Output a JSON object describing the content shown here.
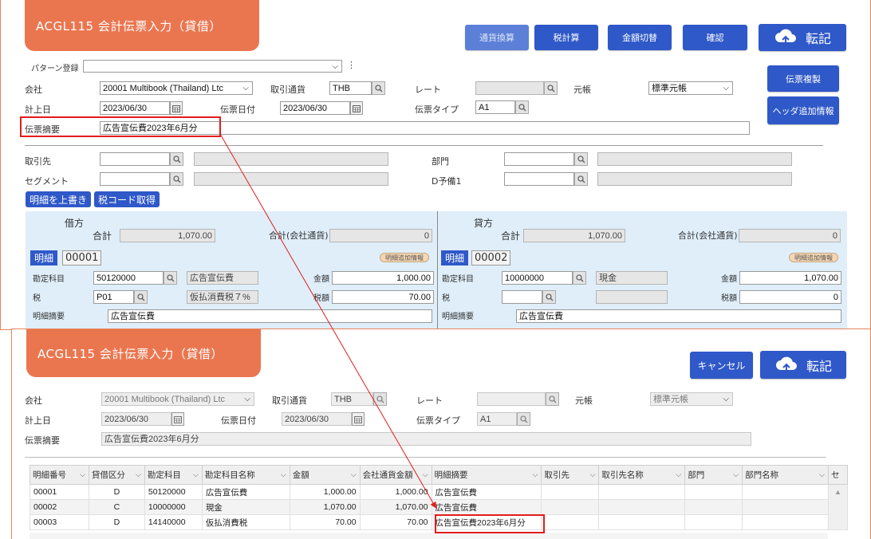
{
  "top": {
    "title": "ACGL115 会計伝票入力（貸借）",
    "buttons": {
      "currency": "通貨換算",
      "tax_calc": "税計算",
      "amount_switch": "金額切替",
      "confirm": "確認",
      "post": "転記",
      "copy": "伝票複製",
      "header_info": "ヘッダ追加情報"
    },
    "pattern_label": "パターン登録",
    "company_label": "会社",
    "company_value": "20001 Multibook (Thailand) Ltc",
    "currency_label": "取引通貨",
    "currency_value": "THB",
    "rate_label": "レート",
    "ledger_label": "元帳",
    "ledger_value": "標準元帳",
    "post_date_label": "計上日",
    "post_date_value": "2023/06/30",
    "slip_date_label": "伝票日付",
    "slip_date_value": "2023/06/30",
    "slip_type_label": "伝票タイプ",
    "slip_type_value": "A1",
    "summary_label": "伝票摘要",
    "summary_value": "広告宣伝費2023年6月分",
    "partner_label": "取引先",
    "dept_label": "部門",
    "segment_label": "セグメント",
    "d1_label": "D予備1",
    "overwrite_btn": "明細を上書き",
    "taxcode_btn": "税コード取得",
    "debit": {
      "heading": "借方",
      "total_label": "合計",
      "total_value": "1,070.00",
      "company_total_label": "合計(会社通貨)",
      "company_total_value": "0",
      "detail_label": "明細",
      "detail_no": "00001",
      "extra_chip": "明細追加情報",
      "account_label": "勘定科目",
      "account_code": "50120000",
      "account_name": "広告宣伝費",
      "amount_label": "金額",
      "amount_value": "1,000.00",
      "tax_label": "税",
      "tax_code": "P01",
      "tax_name": "仮払消費税７%",
      "tax_amount_label": "税額",
      "tax_amount_value": "70.00",
      "line_summary_label": "明細摘要",
      "line_summary_value": "広告宣伝費"
    },
    "credit": {
      "heading": "貸方",
      "total_label": "合計",
      "total_value": "1,070.00",
      "company_total_label": "合計(会社通貨)",
      "company_total_value": "0",
      "detail_label": "明細",
      "detail_no": "00002",
      "extra_chip": "明細追加情報",
      "account_label": "勘定科目",
      "account_code": "10000000",
      "account_name": "現金",
      "amount_label": "金額",
      "amount_value": "1,070.00",
      "tax_label": "税",
      "tax_amount_label": "税額",
      "tax_amount_value": "0",
      "line_summary_label": "明細摘要",
      "line_summary_value": "広告宣伝費"
    }
  },
  "bottom": {
    "title": "ACGL115 会計伝票入力（貸借）",
    "cancel_btn": "キャンセル",
    "post_btn": "転記",
    "company_label": "会社",
    "company_value": "20001 Multibook (Thailand) Ltc",
    "currency_label": "取引通貨",
    "currency_value": "THB",
    "rate_label": "レート",
    "ledger_label": "元帳",
    "ledger_value": "標準元帳",
    "post_date_label": "計上日",
    "post_date_value": "2023/06/30",
    "slip_date_label": "伝票日付",
    "slip_date_value": "2023/06/30",
    "slip_type_label": "伝票タイプ",
    "slip_type_value": "A1",
    "summary_label": "伝票摘要",
    "summary_value": "広告宣伝費2023年6月分",
    "grid": {
      "columns": [
        "明細番号",
        "貸借区分",
        "勘定科目",
        "勘定科目名称",
        "金額",
        "会社通貨金額",
        "明細摘要",
        "取引先",
        "取引先名称",
        "部門",
        "部門名称",
        "セ"
      ],
      "rows": [
        [
          "00001",
          "D",
          "50120000",
          "広告宣伝費",
          "1,000.00",
          "1,000.00",
          "広告宣伝費",
          "",
          "",
          "",
          ""
        ],
        [
          "00002",
          "C",
          "10000000",
          "現金",
          "1,070.00",
          "1,070.00",
          "広告宣伝費",
          "",
          "",
          "",
          ""
        ],
        [
          "00003",
          "D",
          "14140000",
          "仮払消費税",
          "70.00",
          "70.00",
          "広告宣伝費2023年6月分",
          "",
          "",
          "",
          ""
        ]
      ]
    }
  },
  "colors": {
    "accent": "#ea7650",
    "button": "#2f58c8",
    "highlight": "#e31c1c"
  }
}
